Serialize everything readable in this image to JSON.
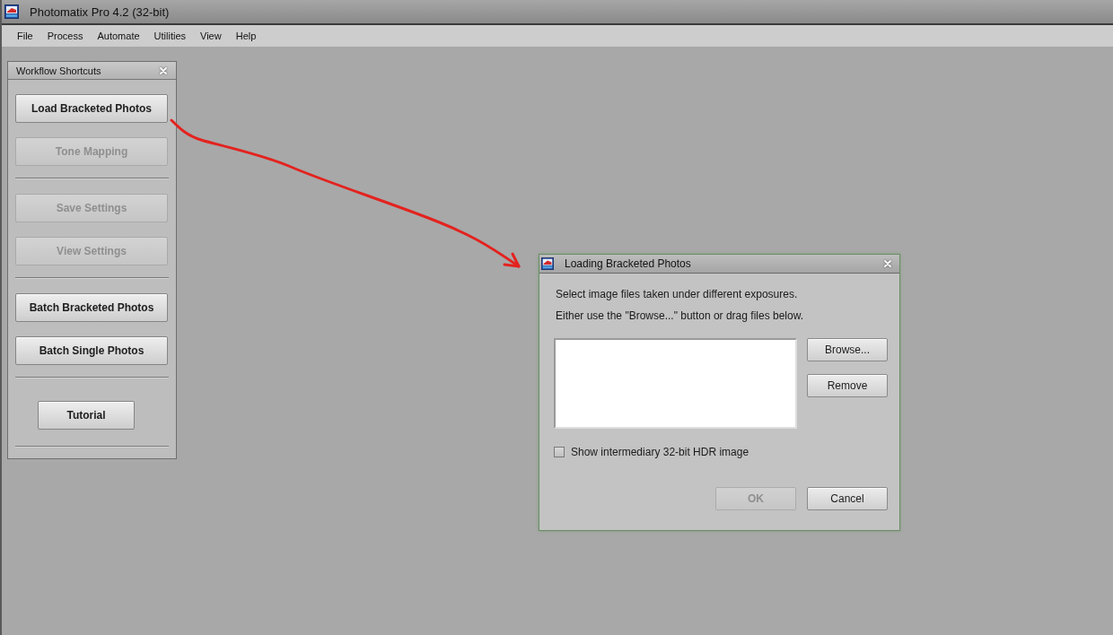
{
  "window": {
    "title": "Photomatix Pro 4.2 (32-bit)"
  },
  "menu": [
    "File",
    "Process",
    "Automate",
    "Utilities",
    "View",
    "Help"
  ],
  "workflow_panel": {
    "title": "Workflow Shortcuts",
    "sections": [
      {
        "buttons": [
          {
            "label": "Load Bracketed Photos",
            "kind": "wide",
            "disabled": false
          },
          {
            "label": "Tone Mapping",
            "kind": "wide",
            "disabled": true
          }
        ]
      },
      {
        "buttons": [
          {
            "label": "Save Settings",
            "kind": "wide",
            "disabled": true
          },
          {
            "label": "View Settings",
            "kind": "wide",
            "disabled": true
          }
        ]
      },
      {
        "buttons": [
          {
            "label": "Batch Bracketed Photos",
            "kind": "wide",
            "disabled": false
          },
          {
            "label": "Batch Single Photos",
            "kind": "wide",
            "disabled": false
          }
        ]
      },
      {
        "buttons": [
          {
            "label": "Tutorial",
            "kind": "narrow",
            "disabled": false
          }
        ]
      }
    ]
  },
  "dialog": {
    "title": "Loading Bracketed Photos",
    "instructions": [
      "Select image files taken under different exposures.",
      "Either use the \"Browse...\" button or drag files below."
    ],
    "side_buttons": [
      {
        "label": "Browse...",
        "disabled": false
      },
      {
        "label": "Remove",
        "disabled": false
      }
    ],
    "checkbox": {
      "label": "Show intermediary 32-bit HDR image",
      "checked": false
    },
    "buttons": [
      {
        "label": "OK",
        "disabled": true
      },
      {
        "label": "Cancel",
        "disabled": false
      }
    ]
  }
}
